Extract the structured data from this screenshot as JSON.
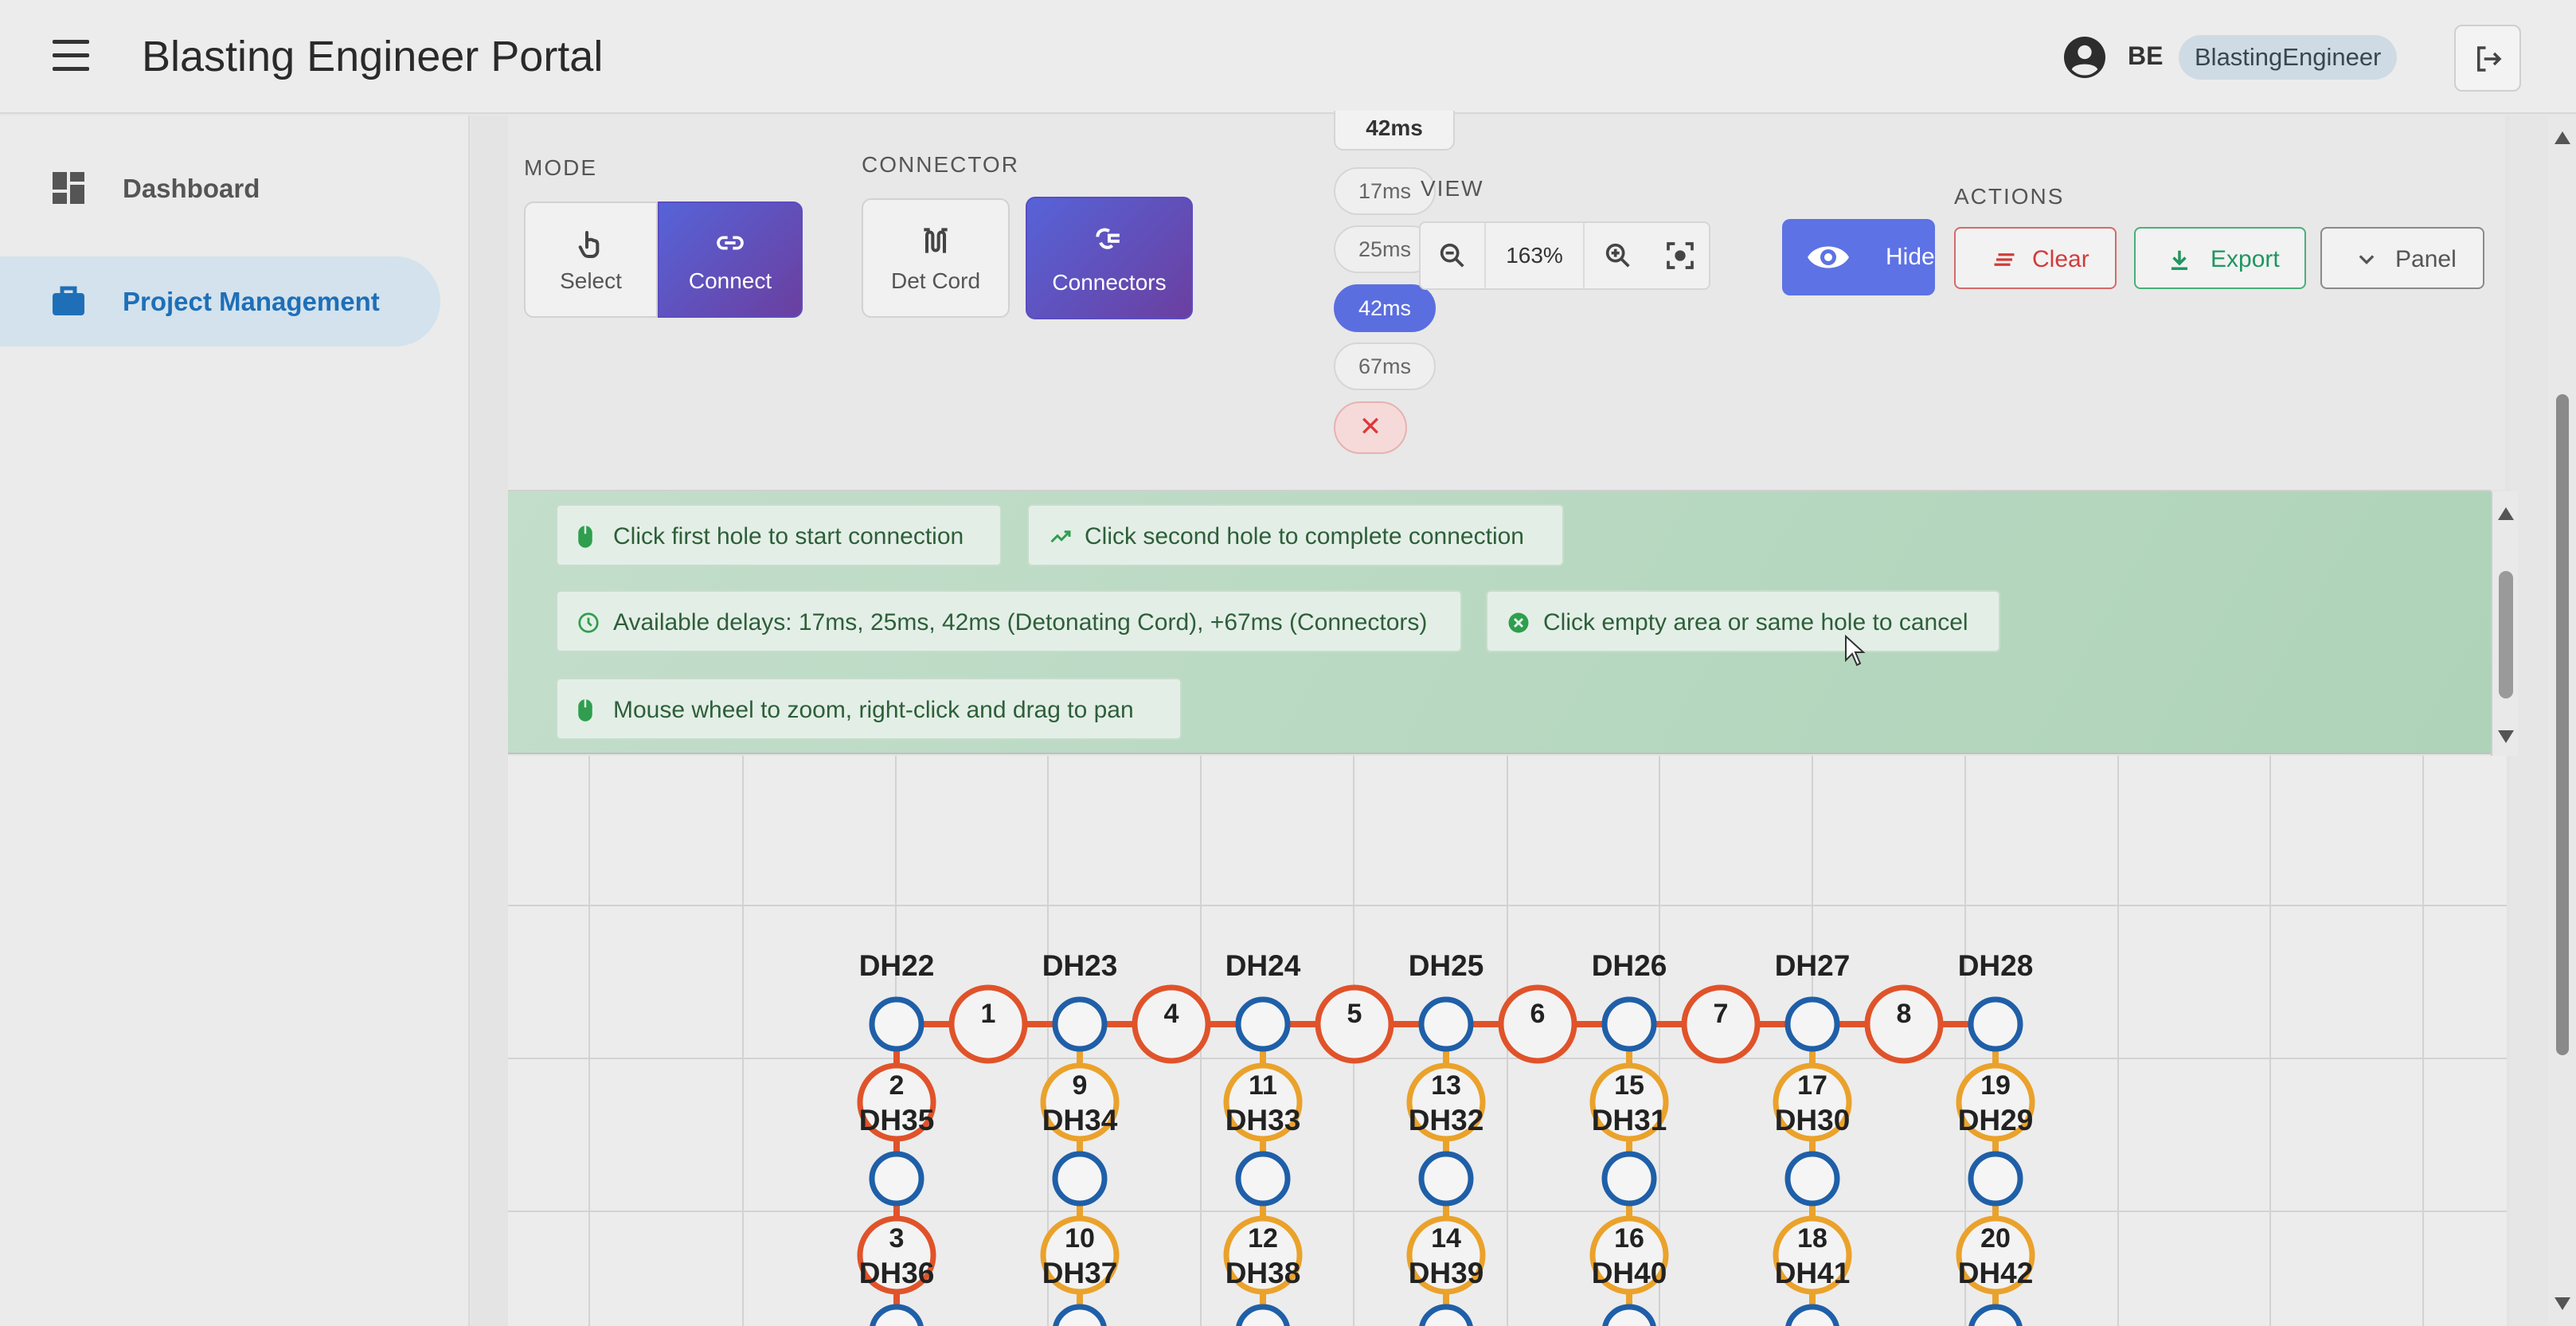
{
  "header": {
    "title": "Blasting Engineer Portal",
    "user_initials": "BE",
    "user_role": "BlastingEngineer"
  },
  "sidebar": {
    "items": [
      {
        "label": "Dashboard",
        "icon": "dashboard-icon",
        "active": false
      },
      {
        "label": "Project Management",
        "icon": "briefcase-icon",
        "active": true
      }
    ]
  },
  "toolbar": {
    "mode_label": "MODE",
    "mode_select": "Select",
    "mode_connect": "Connect",
    "connector_label": "CONNECTOR",
    "det_cord": "Det Cord",
    "connectors": "Connectors",
    "current_delay": "42ms",
    "delays": [
      "17ms",
      "25ms",
      "42ms",
      "67ms"
    ],
    "selected_delay": "42ms",
    "cancel_symbol": "✕",
    "view_label": "VIEW",
    "zoom": "163%",
    "hide": "Hide",
    "actions_label": "ACTIONS",
    "clear": "Clear",
    "export": "Export",
    "panel": "Panel"
  },
  "instructions": {
    "first": "Click first hole to start connection",
    "second": "Click second hole to complete connection",
    "delays": "Available delays: 17ms, 25ms, 42ms (Detonating Cord), +67ms (Connectors)",
    "cancel": "Click empty area or same hole to cancel",
    "zoom": "Mouse wheel to zoom, right-click and drag to pan"
  },
  "holes": {
    "top_row": [
      "DH22",
      "DH23",
      "DH24",
      "DH25",
      "DH26",
      "DH27",
      "DH28"
    ],
    "middle_row": [
      "DH35",
      "DH34",
      "DH33",
      "DH32",
      "DH31",
      "DH30",
      "DH29"
    ],
    "bottom_row": [
      "DH36",
      "DH37",
      "DH38",
      "DH39",
      "DH40",
      "DH41",
      "DH42"
    ],
    "top_connectors": [
      "1",
      "4",
      "5",
      "6",
      "7",
      "8"
    ],
    "col_connectors_mid": [
      "2",
      "9",
      "11",
      "13",
      "15",
      "17",
      "19"
    ],
    "col_connectors_bot": [
      "3",
      "10",
      "12",
      "14",
      "16",
      "18",
      "20"
    ]
  },
  "colors": {
    "hole": "#1f5fa8",
    "red_connector": "#e0532a",
    "orange_connector": "#eaa22b",
    "accent": "#5b6ee0"
  }
}
